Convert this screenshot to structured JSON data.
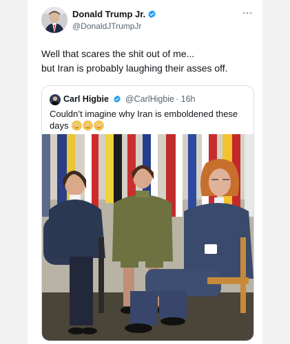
{
  "tweet": {
    "author_name": "Donald Trump Jr.",
    "author_handle": "@DonaldJTrumpJr",
    "text_line1": "Well that scares the shit out of me...",
    "text_line2": "but Iran is probably laughing their asses off.",
    "more_icon": "more-dots-icon",
    "verified_color": "#1d9bf0"
  },
  "quoted_tweet": {
    "author_name": "Carl Higbie",
    "author_handle": "@CarlHigbie",
    "time": "· 16h",
    "text": "Couldn’t imagine why Iran is emboldened these days",
    "emojis": [
      "flushed-face-icon",
      "flushed-face-icon",
      "flushed-face-icon"
    ]
  }
}
